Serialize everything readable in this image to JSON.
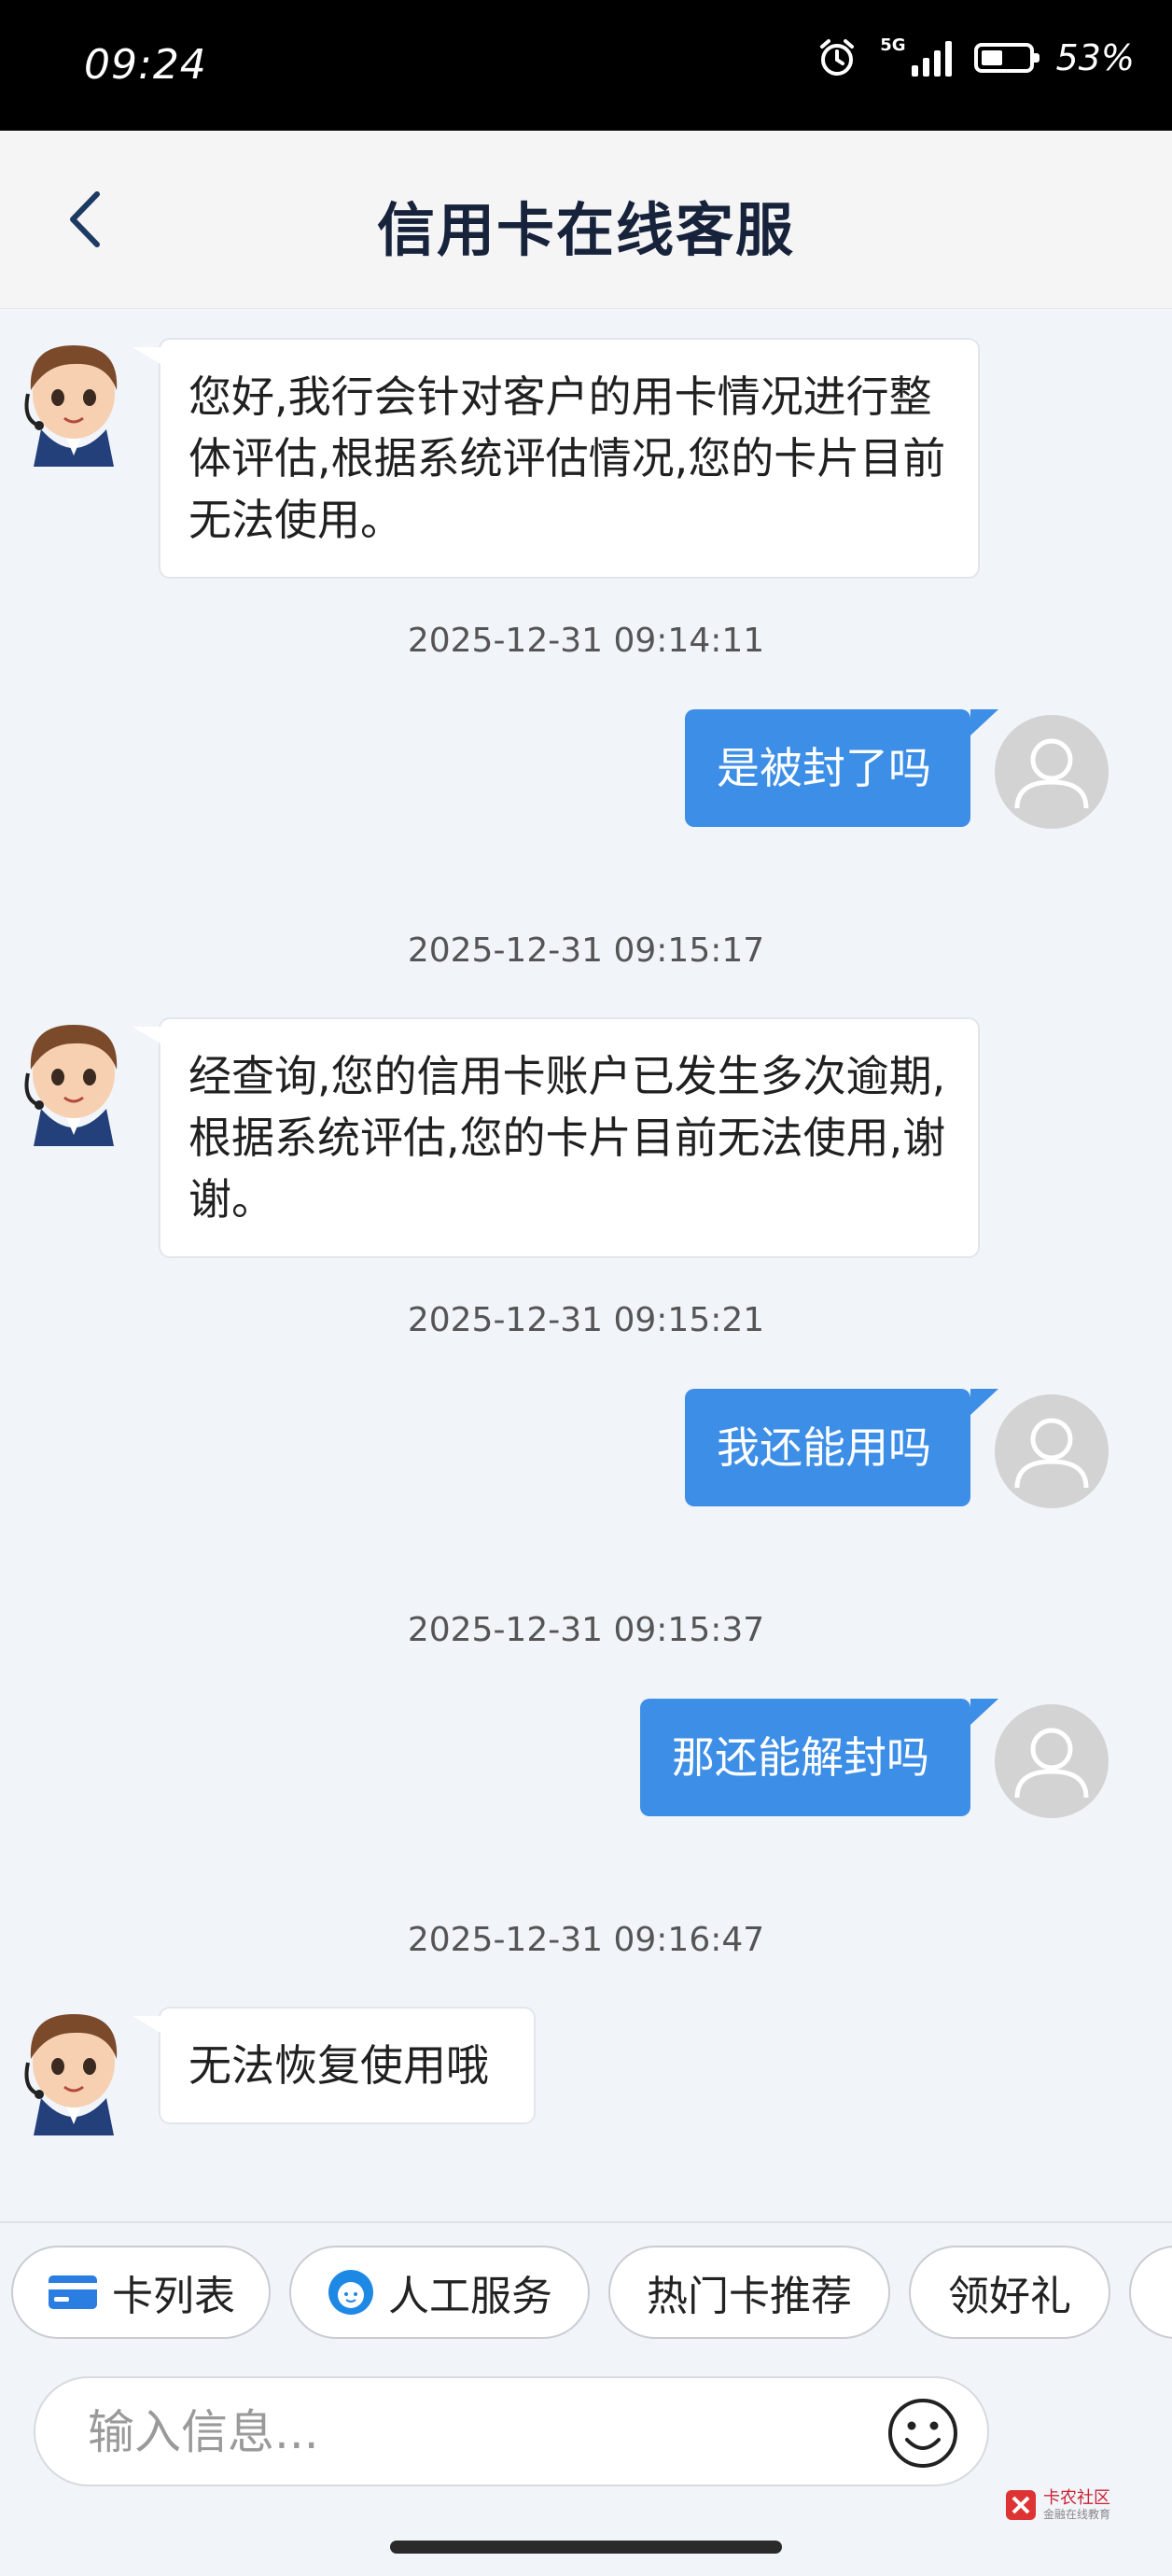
{
  "status_bar": {
    "time": "09:24",
    "network": "5G",
    "battery": "53%",
    "battery_level": 0.53,
    "icons": [
      "alarm-icon",
      "signal-icon",
      "battery-icon"
    ]
  },
  "header": {
    "title": "信用卡在线客服",
    "back_icon": "chevron-left-icon"
  },
  "messages": [
    {
      "from": "agent",
      "text": "您好,我行会针对客户的用卡情况进行整体评估,根据系统评估情况,您的卡片目前无法使用。"
    },
    {
      "timestamp": "2025-12-31 09:14:11"
    },
    {
      "from": "user",
      "text": "是被封了吗"
    },
    {
      "timestamp": "2025-12-31 09:15:17"
    },
    {
      "from": "agent",
      "text": "经查询,您的信用卡账户已发生多次逾期,根据系统评估,您的卡片目前无法使用,谢谢。"
    },
    {
      "timestamp": "2025-12-31 09:15:21"
    },
    {
      "from": "user",
      "text": "我还能用吗"
    },
    {
      "timestamp": "2025-12-31 09:15:37"
    },
    {
      "from": "user",
      "text": "那还能解封吗"
    },
    {
      "timestamp": "2025-12-31 09:16:47"
    },
    {
      "from": "agent",
      "text": "无法恢复使用哦"
    }
  ],
  "quick_replies": [
    {
      "label": "卡列表",
      "icon": "credit-card-icon"
    },
    {
      "label": "人工服务",
      "icon": "customer-service-icon"
    },
    {
      "label": "热门卡推荐"
    },
    {
      "label": "领好礼"
    }
  ],
  "input": {
    "placeholder": "输入信息...",
    "emoji_icon": "smiley-icon"
  },
  "watermark": {
    "text": "卡农社区",
    "subtext": "金融在线教育"
  },
  "colors": {
    "accent": "#3d8ee6",
    "background": "#f1f4f9",
    "title": "#17223b"
  }
}
